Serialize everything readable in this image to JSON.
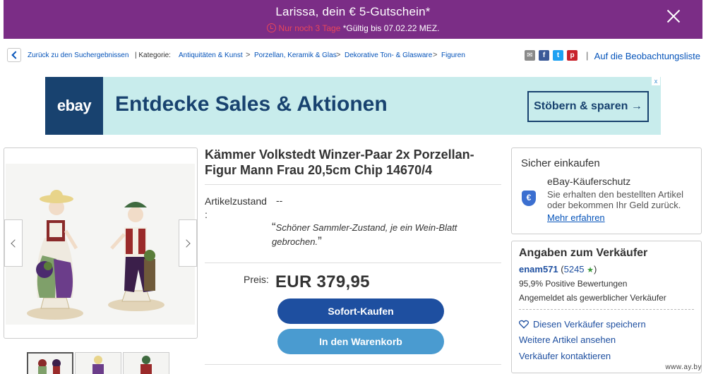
{
  "promo": {
    "title": "Larissa, dein € 5-Gutschein*",
    "urgency": "Nur noch 3 Tage",
    "validity": "*Gültig bis 07.02.22 MEZ.",
    "close_icon": "close-icon"
  },
  "breadcrumb": {
    "back_label": "Zurück zu den Suchergebnissen",
    "category_label": "| Kategorie:",
    "items": [
      "Antiquitäten & Kunst",
      "Porzellan, Keramik & Glas",
      "Dekorative Ton- & Glasware",
      "Figuren"
    ],
    "separator": ">",
    "watch_label": "Auf die Beobachtungsliste"
  },
  "share_icons": [
    "email-icon",
    "facebook-icon",
    "twitter-icon",
    "pinterest-icon"
  ],
  "ad": {
    "logo": "ebay",
    "headline": "Entdecke Sales & Aktionen",
    "cta": "Stöbern & sparen →",
    "info": "x"
  },
  "listing": {
    "title": "Kämmer Volkstedt Winzer-Paar 2x Porzellan-Figur Mann Frau 20,5cm Chip 14670/4",
    "condition_label": "Artikelzustand :",
    "condition_value": "--",
    "condition_note": "Schöner Sammler-Zustand, je ein Wein-Blatt gebrochen.",
    "price_label": "Preis:",
    "price": "EUR 379,95",
    "buy_now": "Sofort-Kaufen",
    "add_to_cart": "In den Warenkorb"
  },
  "protection": {
    "heading": "Sicher einkaufen",
    "title": "eBay-Käuferschutz",
    "description": "Sie erhalten den bestellten Artikel oder bekommen Ihr Geld zurück.",
    "link": "Mehr erfahren"
  },
  "seller": {
    "heading": "Angaben zum Verkäufer",
    "name": "enam571",
    "score": "5245",
    "positive": "95,9% Positive Bewertungen",
    "type": "Angemeldet als gewerblicher Verkäufer",
    "save": "Diesen Verkäufer speichern",
    "more": "Weitere Artikel ansehen",
    "contact": "Verkäufer kontaktieren"
  },
  "watermark": "www.ay.by",
  "colors": {
    "promo_bg": "#7b2d86",
    "urgent": "#e8465a",
    "link": "#0654ba",
    "buy_button": "#1e4fa0",
    "cart_button": "#4a9bd0",
    "ad_bg": "#c8ecec",
    "ad_dark": "#18426f"
  }
}
